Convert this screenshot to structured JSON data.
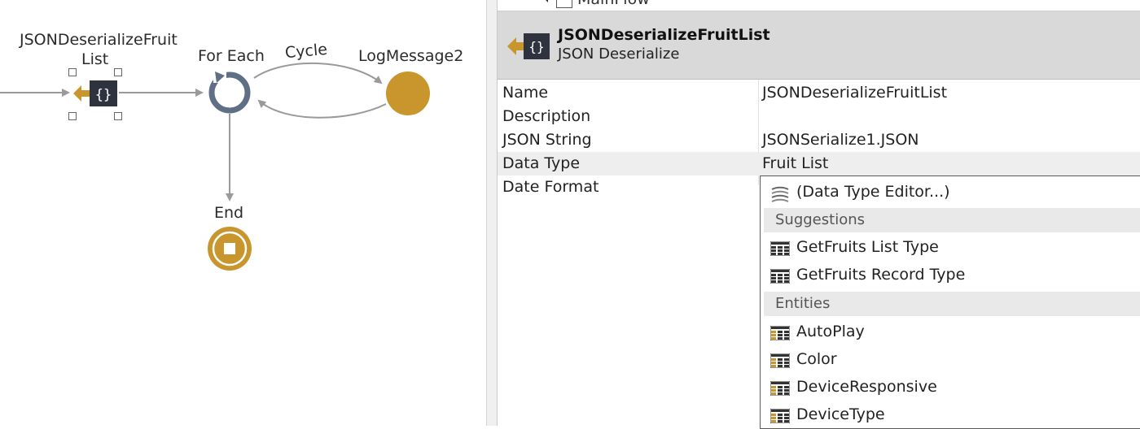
{
  "canvas": {
    "nodes": {
      "deserialize_label_line1": "JSONDeserializeFruit",
      "deserialize_label_line2": "List",
      "foreach_label": "For Each",
      "cycle_label": "Cycle",
      "logmessage_label": "LogMessage2",
      "end_label": "End"
    }
  },
  "tree": {
    "partial_item": "MainFlow"
  },
  "panel": {
    "header": {
      "title": "JSONDeserializeFruitList",
      "subtitle": "JSON Deserialize"
    },
    "properties": [
      {
        "name": "Name",
        "value": "JSONDeserializeFruitList"
      },
      {
        "name": "Description",
        "value": ""
      },
      {
        "name": "JSON String",
        "value": "JSONSerialize1.JSON"
      },
      {
        "name": "Data Type",
        "value": "Fruit List"
      },
      {
        "name": "Date Format",
        "value": ""
      }
    ]
  },
  "dropdown": {
    "editor_item": "(Data Type Editor...)",
    "sections": {
      "suggestions": "Suggestions",
      "entities": "Entities"
    },
    "suggestions": [
      "GetFruits List Type",
      "GetFruits Record Type"
    ],
    "entities": [
      "AutoPlay",
      "Color",
      "DeviceResponsive",
      "DeviceType"
    ]
  },
  "colors": {
    "accent_gold": "#C9962E",
    "node_dark": "#2f3340",
    "foreach_ring": "#5e6f86",
    "connector": "#9a9a9a",
    "header_bg": "#d9d9d9",
    "section_bg": "#e9e9e9"
  },
  "icons": {
    "deserialize": "json-deserialize-icon",
    "foreach": "foreach-cycle-icon",
    "end": "end-stop-icon",
    "editor": "data-type-editor-icon",
    "structure": "structure-grid-icon",
    "entity": "entity-grid-icon"
  }
}
